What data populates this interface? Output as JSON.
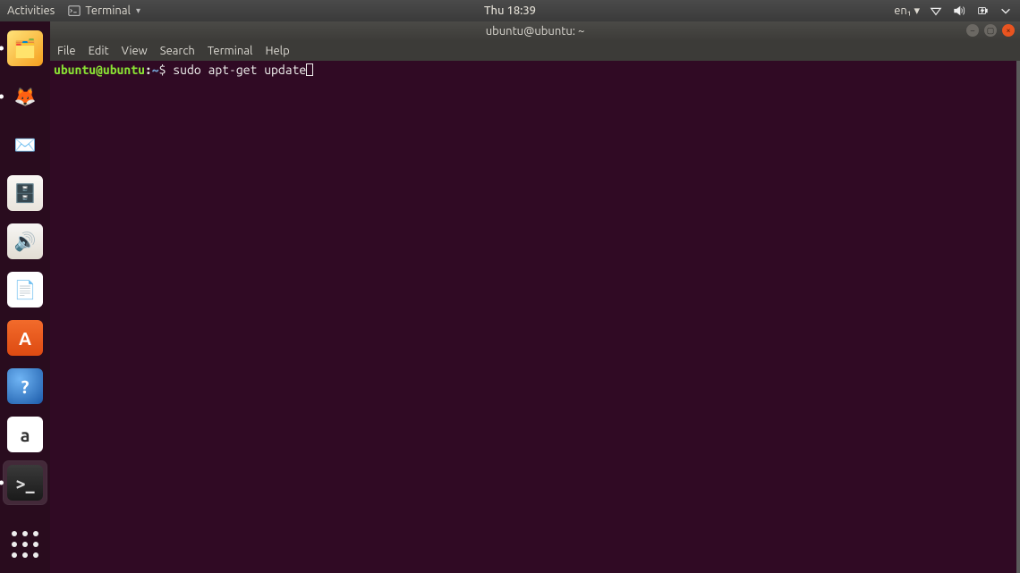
{
  "top_panel": {
    "activities": "Activities",
    "app_name": "Terminal",
    "clock": "Thu 18:39",
    "input_source": "en₁",
    "tray": [
      "network-icon",
      "volume-icon",
      "battery-icon",
      "power-menu-icon"
    ]
  },
  "launcher": {
    "items": [
      {
        "name": "torrent-app",
        "running": true,
        "bg": "linear-gradient(135deg,#ffe37a,#f59f1f)",
        "glyph": "🗂️"
      },
      {
        "name": "firefox",
        "running": true,
        "bg": "transparent",
        "glyph": "🦊"
      },
      {
        "name": "thunderbird",
        "running": false,
        "bg": "transparent",
        "glyph": "✉️"
      },
      {
        "name": "files",
        "running": false,
        "bg": "linear-gradient(#faf8f5,#e9e4dc)",
        "glyph": "🗄️"
      },
      {
        "name": "rhythmbox",
        "running": false,
        "bg": "linear-gradient(#f7f6f4,#e2ddd3)",
        "glyph": "🔊"
      },
      {
        "name": "libreoffice-writer",
        "running": false,
        "bg": "#fff",
        "glyph": "📄"
      },
      {
        "name": "ubuntu-software",
        "running": false,
        "bg": "linear-gradient(#f26b2b,#dd4a12)",
        "glyph": "A"
      },
      {
        "name": "help",
        "running": false,
        "bg": "radial-gradient(circle at 35% 30%,#6fb4f4,#1b5aa8)",
        "glyph": "?"
      },
      {
        "name": "amazon",
        "running": false,
        "bg": "#fff",
        "glyph": "a"
      },
      {
        "name": "terminal",
        "running": true,
        "active": true,
        "bg": "linear-gradient(#3a3a3a,#1a1a1a)",
        "glyph": ">_"
      }
    ]
  },
  "window": {
    "title": "ubuntu@ubuntu: ~",
    "menu": [
      "File",
      "Edit",
      "View",
      "Search",
      "Terminal",
      "Help"
    ]
  },
  "terminal": {
    "user": "ubuntu@ubuntu",
    "path": "~",
    "command": "sudo apt-get update"
  }
}
